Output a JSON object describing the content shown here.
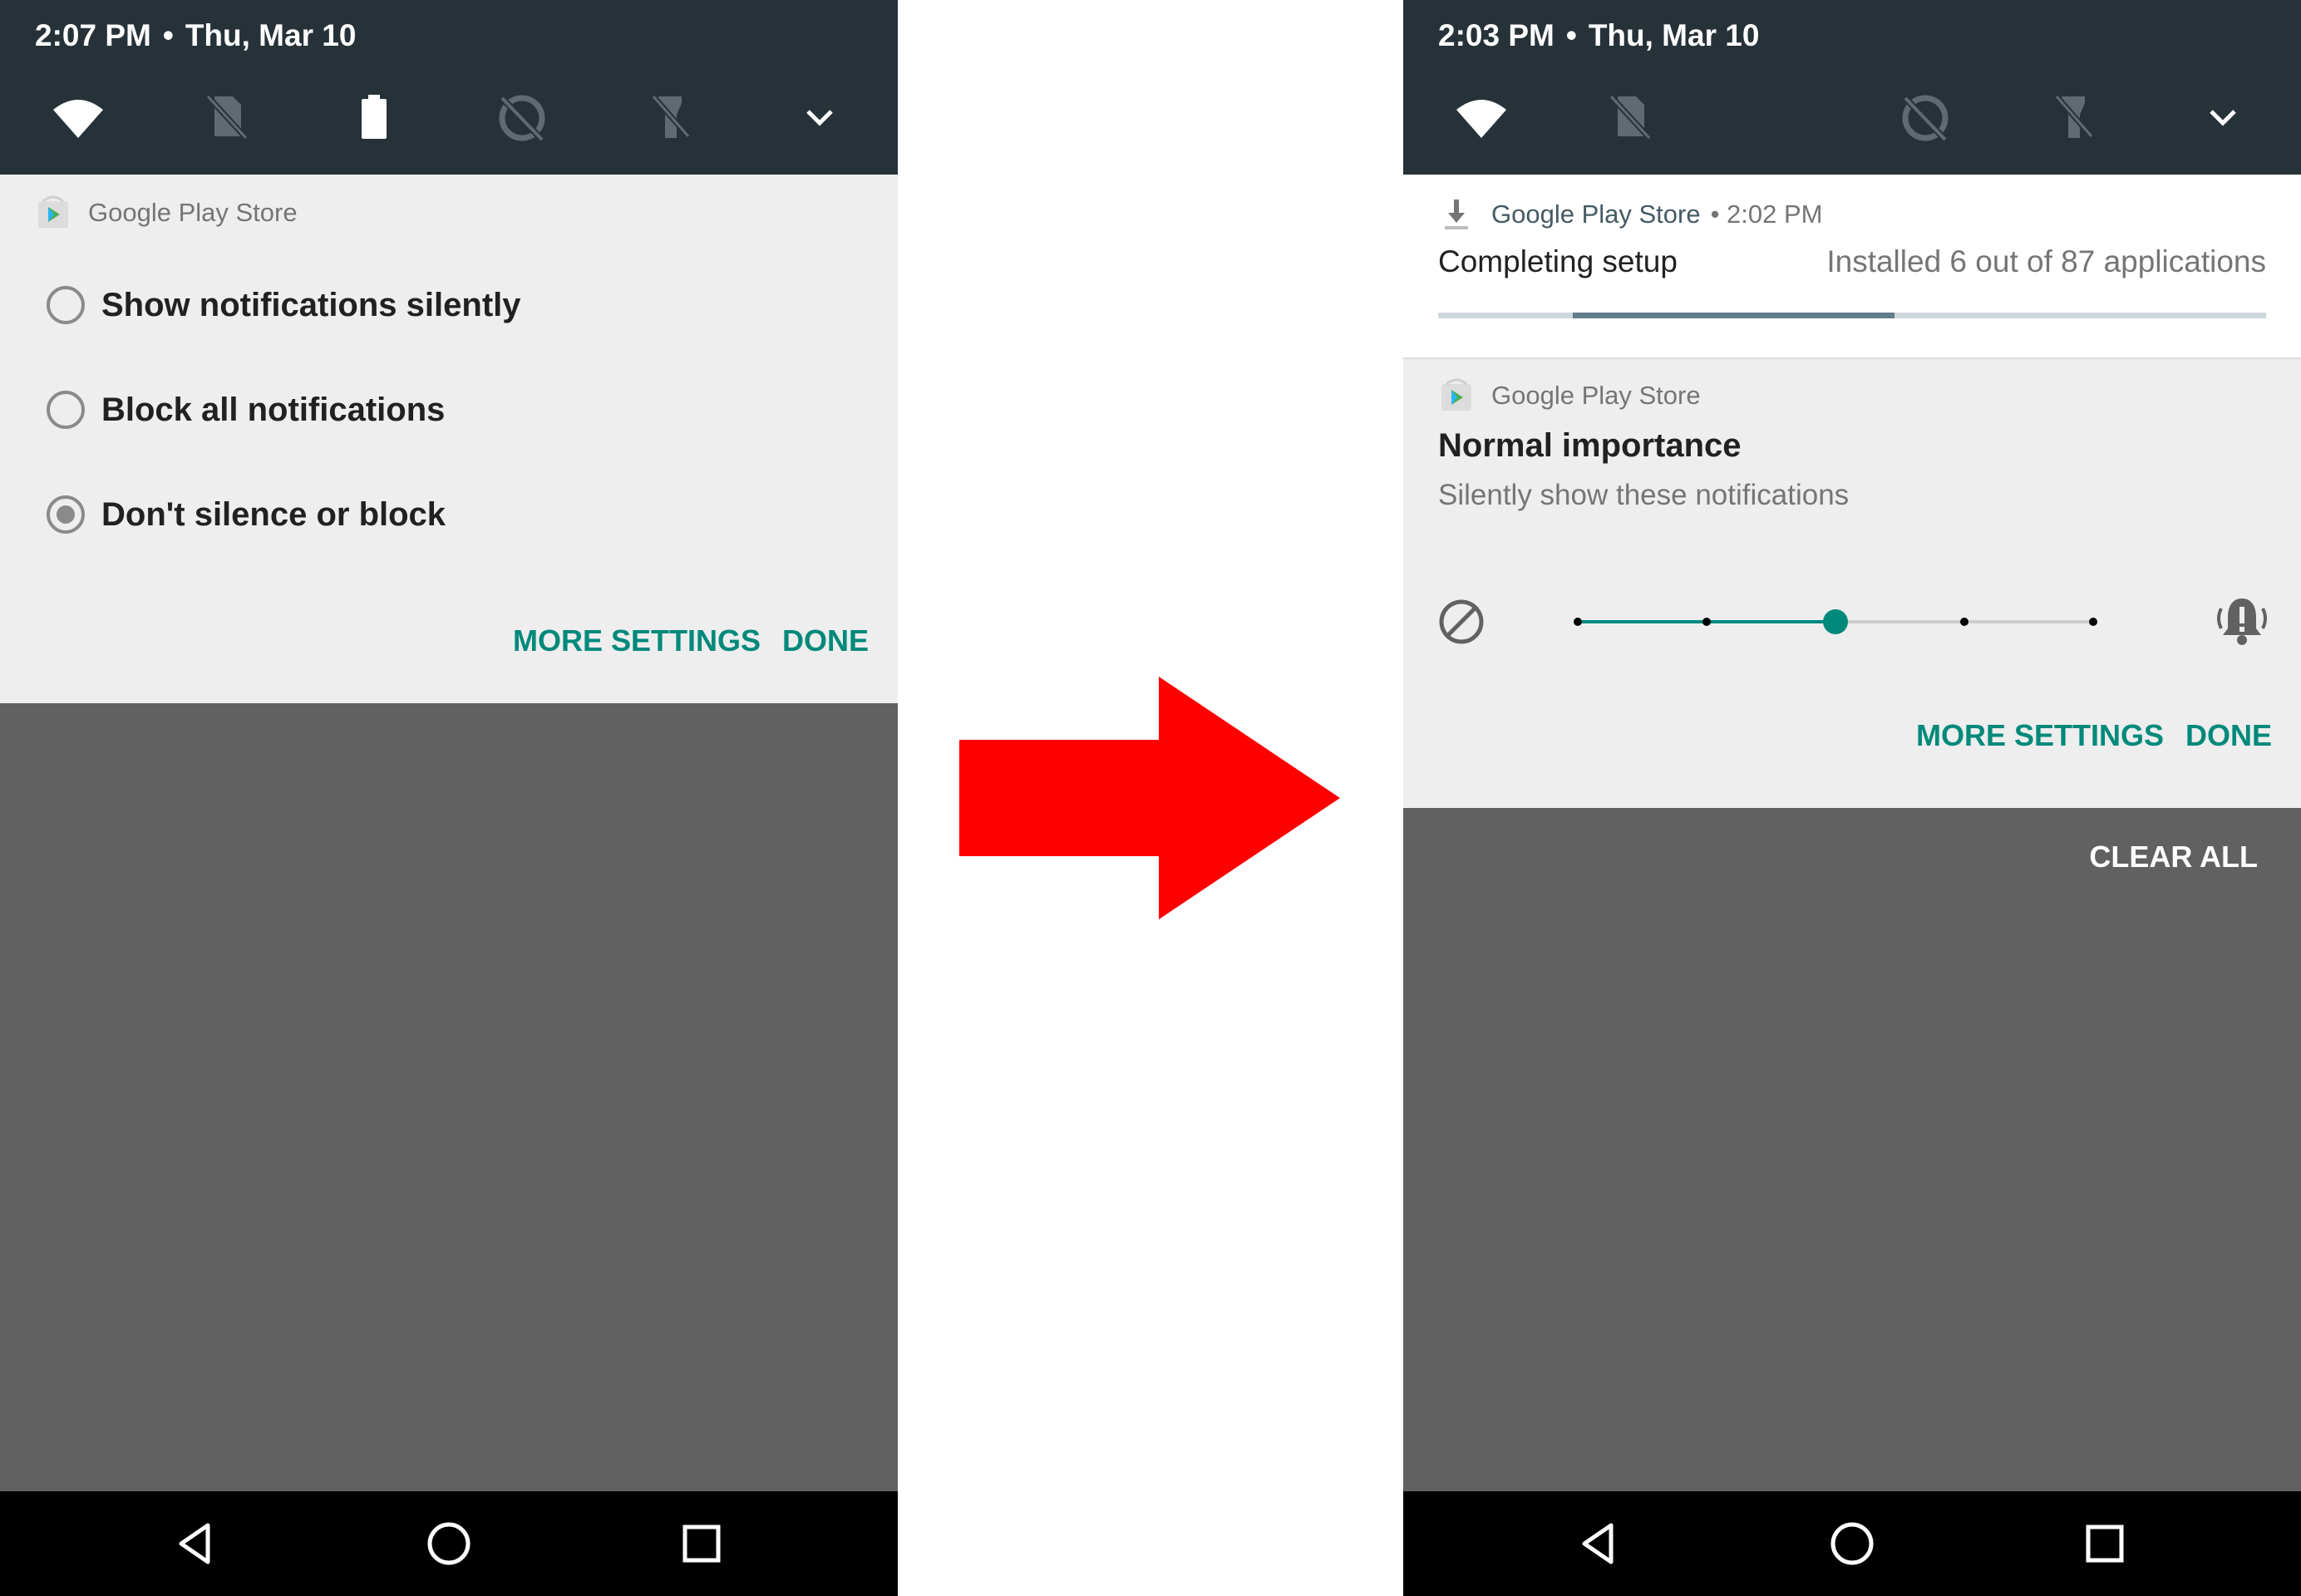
{
  "left_screen": {
    "status": {
      "time": "2:07 PM",
      "separator": "•",
      "date": "Thu, Mar 10"
    },
    "quick_settings_icons": [
      "wifi-icon",
      "no-sim-icon",
      "battery-icon",
      "data-saver-off-icon",
      "flashlight-off-icon",
      "expand-chevron-icon"
    ],
    "notification": {
      "app_name": "Google Play Store",
      "options": [
        {
          "label": "Show notifications silently",
          "checked": false
        },
        {
          "label": "Block all notifications",
          "checked": false
        },
        {
          "label": "Don't silence or block",
          "checked": true
        }
      ],
      "more_settings": "MORE SETTINGS",
      "done": "DONE"
    }
  },
  "right_screen": {
    "status": {
      "time": "2:03 PM",
      "separator": "•",
      "date": "Thu, Mar 10"
    },
    "quick_settings_icons": [
      "wifi-icon",
      "no-sim-icon",
      "data-saver-off-icon",
      "flashlight-off-icon",
      "expand-chevron-icon"
    ],
    "setup_notification": {
      "app_name": "Google Play Store",
      "time_meta": "• 2:02 PM",
      "title": "Completing setup",
      "detail": "Installed 6 out of 87 applications"
    },
    "importance_notification": {
      "app_name": "Google Play Store",
      "title": "Normal importance",
      "subtitle": "Silently show these notifications",
      "slider_level": 2,
      "slider_steps": 5,
      "more_settings": "MORE SETTINGS",
      "done": "DONE"
    },
    "clear_all": "CLEAR ALL"
  },
  "nav_icons": [
    "back-icon",
    "home-icon",
    "recents-icon"
  ],
  "colors": {
    "accent": "#00897b",
    "status_bar": "#263238",
    "panel": "#eeeeee",
    "shade": "#616161",
    "arrow": "#ff0000"
  }
}
